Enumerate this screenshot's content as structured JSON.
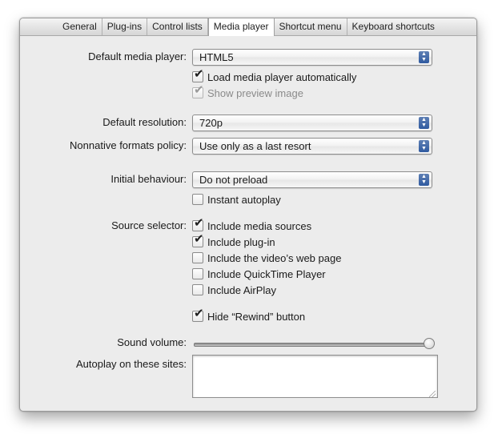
{
  "tabs": [
    "General",
    "Plug-ins",
    "Control lists",
    "Media player",
    "Shortcut menu",
    "Keyboard shortcuts"
  ],
  "active_tab": "Media player",
  "default_media_player": {
    "label": "Default media player:",
    "value": "HTML5"
  },
  "load_auto": {
    "label": "Load media player automatically",
    "checked": true
  },
  "show_preview": {
    "label": "Show preview image",
    "checked": true,
    "disabled": true
  },
  "default_resolution": {
    "label": "Default resolution:",
    "value": "720p"
  },
  "nonnative_policy": {
    "label": "Nonnative formats policy:",
    "value": "Use only as a last resort"
  },
  "initial_behaviour": {
    "label": "Initial behaviour:",
    "value": "Do not preload"
  },
  "instant_autoplay": {
    "label": "Instant autoplay",
    "checked": false
  },
  "source_selector": {
    "label": "Source selector:",
    "options": [
      {
        "label": "Include media sources",
        "checked": true
      },
      {
        "label": "Include plug-in",
        "checked": true
      },
      {
        "label": "Include the video’s web page",
        "checked": false
      },
      {
        "label": "Include QuickTime Player",
        "checked": false
      },
      {
        "label": "Include AirPlay",
        "checked": false
      }
    ]
  },
  "hide_rewind": {
    "label": "Hide “Rewind” button",
    "checked": true
  },
  "sound_volume": {
    "label": "Sound volume:",
    "value_fraction": 1.0
  },
  "autoplay_sites": {
    "label": "Autoplay on these sites:",
    "value": ""
  },
  "icons": {
    "checkmark": "✔",
    "up": "▲",
    "down": "▼"
  }
}
